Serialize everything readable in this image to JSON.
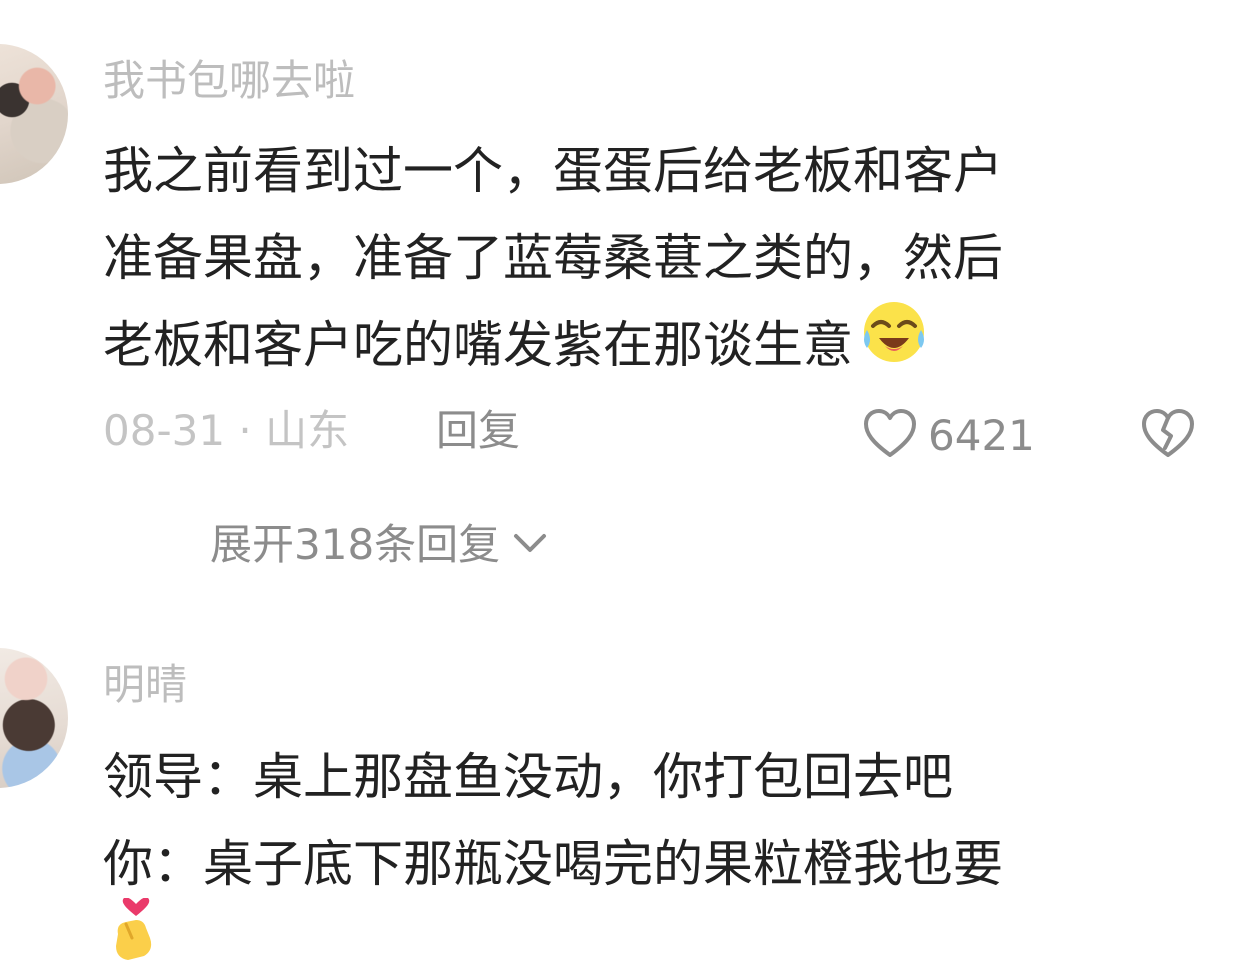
{
  "comments": [
    {
      "username": "我书包哪去啦",
      "lines": [
        "我之前看到过一个，蛋蛋后给老板和客户",
        "准备果盘，准备了蓝莓桑葚之类的，然后",
        "老板和客户吃的嘴发紫在那谈生意"
      ],
      "emoji": "laugh-cry-emoji",
      "date": "08-31",
      "separator": "·",
      "location": "山东",
      "reply_label": "回复",
      "like_count": "6421",
      "expand_label": "展开318条回复"
    },
    {
      "username": "明晴",
      "lines": [
        "领导：桌上那盘鱼没动，你打包回去吧",
        "你：桌子底下那瓶没喝完的果粒橙我也要"
      ],
      "emoji": "finger-heart-emoji"
    }
  ],
  "icons": {
    "like": "heart-outline-icon",
    "dislike": "broken-heart-icon",
    "expand": "chevron-down-icon"
  },
  "colors": {
    "text": "#222222",
    "muted": "#8c8c8c",
    "faint": "#bdbdbd",
    "background": "#ffffff"
  }
}
